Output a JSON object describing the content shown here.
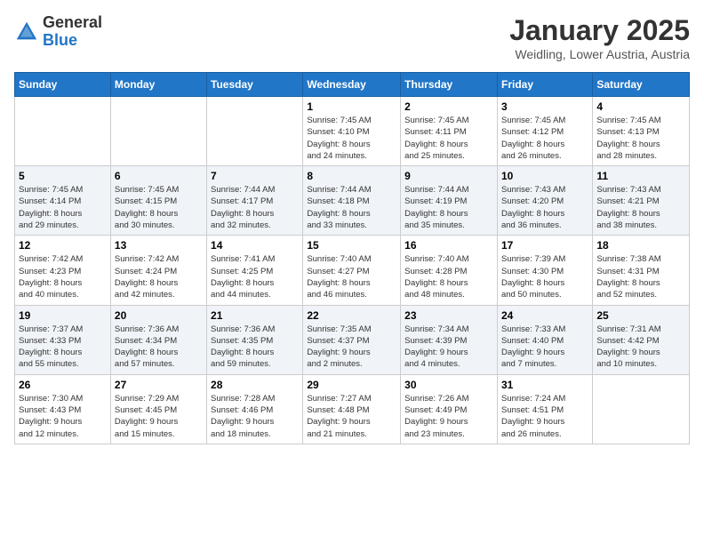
{
  "logo": {
    "general": "General",
    "blue": "Blue"
  },
  "title": {
    "month": "January 2025",
    "location": "Weidling, Lower Austria, Austria"
  },
  "days_header": [
    "Sunday",
    "Monday",
    "Tuesday",
    "Wednesday",
    "Thursday",
    "Friday",
    "Saturday"
  ],
  "weeks": [
    [
      {
        "day": "",
        "info": ""
      },
      {
        "day": "",
        "info": ""
      },
      {
        "day": "",
        "info": ""
      },
      {
        "day": "1",
        "info": "Sunrise: 7:45 AM\nSunset: 4:10 PM\nDaylight: 8 hours\nand 24 minutes."
      },
      {
        "day": "2",
        "info": "Sunrise: 7:45 AM\nSunset: 4:11 PM\nDaylight: 8 hours\nand 25 minutes."
      },
      {
        "day": "3",
        "info": "Sunrise: 7:45 AM\nSunset: 4:12 PM\nDaylight: 8 hours\nand 26 minutes."
      },
      {
        "day": "4",
        "info": "Sunrise: 7:45 AM\nSunset: 4:13 PM\nDaylight: 8 hours\nand 28 minutes."
      }
    ],
    [
      {
        "day": "5",
        "info": "Sunrise: 7:45 AM\nSunset: 4:14 PM\nDaylight: 8 hours\nand 29 minutes."
      },
      {
        "day": "6",
        "info": "Sunrise: 7:45 AM\nSunset: 4:15 PM\nDaylight: 8 hours\nand 30 minutes."
      },
      {
        "day": "7",
        "info": "Sunrise: 7:44 AM\nSunset: 4:17 PM\nDaylight: 8 hours\nand 32 minutes."
      },
      {
        "day": "8",
        "info": "Sunrise: 7:44 AM\nSunset: 4:18 PM\nDaylight: 8 hours\nand 33 minutes."
      },
      {
        "day": "9",
        "info": "Sunrise: 7:44 AM\nSunset: 4:19 PM\nDaylight: 8 hours\nand 35 minutes."
      },
      {
        "day": "10",
        "info": "Sunrise: 7:43 AM\nSunset: 4:20 PM\nDaylight: 8 hours\nand 36 minutes."
      },
      {
        "day": "11",
        "info": "Sunrise: 7:43 AM\nSunset: 4:21 PM\nDaylight: 8 hours\nand 38 minutes."
      }
    ],
    [
      {
        "day": "12",
        "info": "Sunrise: 7:42 AM\nSunset: 4:23 PM\nDaylight: 8 hours\nand 40 minutes."
      },
      {
        "day": "13",
        "info": "Sunrise: 7:42 AM\nSunset: 4:24 PM\nDaylight: 8 hours\nand 42 minutes."
      },
      {
        "day": "14",
        "info": "Sunrise: 7:41 AM\nSunset: 4:25 PM\nDaylight: 8 hours\nand 44 minutes."
      },
      {
        "day": "15",
        "info": "Sunrise: 7:40 AM\nSunset: 4:27 PM\nDaylight: 8 hours\nand 46 minutes."
      },
      {
        "day": "16",
        "info": "Sunrise: 7:40 AM\nSunset: 4:28 PM\nDaylight: 8 hours\nand 48 minutes."
      },
      {
        "day": "17",
        "info": "Sunrise: 7:39 AM\nSunset: 4:30 PM\nDaylight: 8 hours\nand 50 minutes."
      },
      {
        "day": "18",
        "info": "Sunrise: 7:38 AM\nSunset: 4:31 PM\nDaylight: 8 hours\nand 52 minutes."
      }
    ],
    [
      {
        "day": "19",
        "info": "Sunrise: 7:37 AM\nSunset: 4:33 PM\nDaylight: 8 hours\nand 55 minutes."
      },
      {
        "day": "20",
        "info": "Sunrise: 7:36 AM\nSunset: 4:34 PM\nDaylight: 8 hours\nand 57 minutes."
      },
      {
        "day": "21",
        "info": "Sunrise: 7:36 AM\nSunset: 4:35 PM\nDaylight: 8 hours\nand 59 minutes."
      },
      {
        "day": "22",
        "info": "Sunrise: 7:35 AM\nSunset: 4:37 PM\nDaylight: 9 hours\nand 2 minutes."
      },
      {
        "day": "23",
        "info": "Sunrise: 7:34 AM\nSunset: 4:39 PM\nDaylight: 9 hours\nand 4 minutes."
      },
      {
        "day": "24",
        "info": "Sunrise: 7:33 AM\nSunset: 4:40 PM\nDaylight: 9 hours\nand 7 minutes."
      },
      {
        "day": "25",
        "info": "Sunrise: 7:31 AM\nSunset: 4:42 PM\nDaylight: 9 hours\nand 10 minutes."
      }
    ],
    [
      {
        "day": "26",
        "info": "Sunrise: 7:30 AM\nSunset: 4:43 PM\nDaylight: 9 hours\nand 12 minutes."
      },
      {
        "day": "27",
        "info": "Sunrise: 7:29 AM\nSunset: 4:45 PM\nDaylight: 9 hours\nand 15 minutes."
      },
      {
        "day": "28",
        "info": "Sunrise: 7:28 AM\nSunset: 4:46 PM\nDaylight: 9 hours\nand 18 minutes."
      },
      {
        "day": "29",
        "info": "Sunrise: 7:27 AM\nSunset: 4:48 PM\nDaylight: 9 hours\nand 21 minutes."
      },
      {
        "day": "30",
        "info": "Sunrise: 7:26 AM\nSunset: 4:49 PM\nDaylight: 9 hours\nand 23 minutes."
      },
      {
        "day": "31",
        "info": "Sunrise: 7:24 AM\nSunset: 4:51 PM\nDaylight: 9 hours\nand 26 minutes."
      },
      {
        "day": "",
        "info": ""
      }
    ]
  ]
}
